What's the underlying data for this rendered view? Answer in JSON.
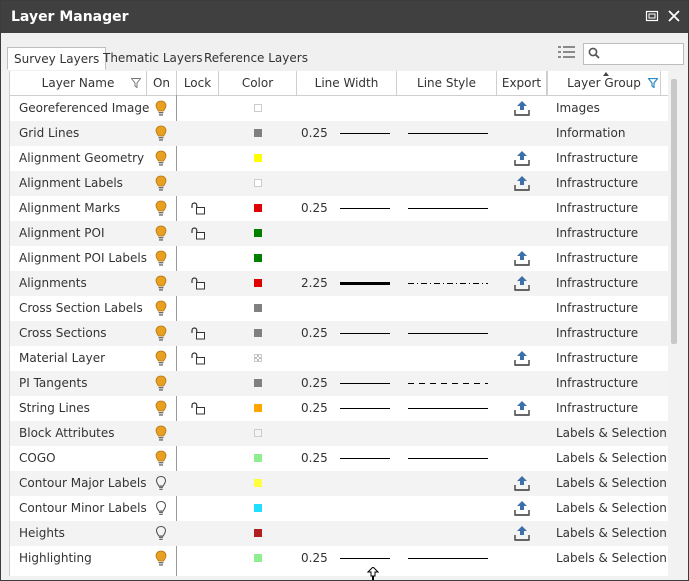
{
  "window": {
    "title": "Layer Manager"
  },
  "tabs": [
    {
      "label": "Survey Layers",
      "active": true
    },
    {
      "label": "Thematic Layers",
      "active": false
    },
    {
      "label": "Reference Layers",
      "active": false
    }
  ],
  "search": {
    "value": "",
    "placeholder": ""
  },
  "columns": {
    "name": "Layer Name",
    "on": "On",
    "lock": "Lock",
    "color": "Color",
    "width": "Line Width",
    "style": "Line Style",
    "export": "Export",
    "group": "Layer Group"
  },
  "colors": {
    "bulb_on": "#e8a020",
    "bulb_off": "#555555",
    "title_bar": "#404040",
    "accent": "#2b6cc4"
  },
  "rows": [
    {
      "name": "Georeferenced Images",
      "on": true,
      "locked": false,
      "color": "#ffffff",
      "width": "",
      "style": "",
      "export": true,
      "group": "Images"
    },
    {
      "name": "Grid Lines",
      "on": true,
      "locked": false,
      "color": "#808080",
      "width": "0.25",
      "style": "solid",
      "export": false,
      "group": "Information"
    },
    {
      "name": "Alignment Geometry",
      "on": true,
      "locked": false,
      "color": "#ffff00",
      "width": "",
      "style": "",
      "export": true,
      "group": "Infrastructure"
    },
    {
      "name": "Alignment Labels",
      "on": true,
      "locked": false,
      "color": "#ffffff",
      "width": "",
      "style": "",
      "export": true,
      "group": "Infrastructure"
    },
    {
      "name": "Alignment Marks",
      "on": true,
      "locked": true,
      "color": "#e00000",
      "width": "0.25",
      "style": "solid",
      "export": false,
      "group": "Infrastructure"
    },
    {
      "name": "Alignment POI",
      "on": true,
      "locked": true,
      "color": "#008000",
      "width": "",
      "style": "",
      "export": false,
      "group": "Infrastructure"
    },
    {
      "name": "Alignment POI Labels",
      "on": true,
      "locked": false,
      "color": "#008000",
      "width": "",
      "style": "",
      "export": true,
      "group": "Infrastructure"
    },
    {
      "name": "Alignments",
      "on": true,
      "locked": true,
      "color": "#e00000",
      "width": "2.25",
      "style": "dashdot",
      "export": true,
      "group": "Infrastructure"
    },
    {
      "name": "Cross Section Labels",
      "on": true,
      "locked": false,
      "color": "#808080",
      "width": "",
      "style": "",
      "export": false,
      "group": "Infrastructure"
    },
    {
      "name": "Cross Sections",
      "on": true,
      "locked": true,
      "color": "#808080",
      "width": "0.25",
      "style": "solid",
      "export": false,
      "group": "Infrastructure"
    },
    {
      "name": "Material Layer",
      "on": true,
      "locked": true,
      "color": "checker",
      "width": "",
      "style": "",
      "export": true,
      "group": "Infrastructure"
    },
    {
      "name": "PI Tangents",
      "on": true,
      "locked": false,
      "color": "#808080",
      "width": "0.25",
      "style": "dashed",
      "export": false,
      "group": "Infrastructure"
    },
    {
      "name": "String Lines",
      "on": true,
      "locked": true,
      "color": "#ffa500",
      "width": "0.25",
      "style": "solid",
      "export": true,
      "group": "Infrastructure"
    },
    {
      "name": "Block Attributes",
      "on": true,
      "locked": false,
      "color": "#f4f4f4",
      "width": "",
      "style": "",
      "export": false,
      "group": "Labels & Selection"
    },
    {
      "name": "COGO",
      "on": true,
      "locked": false,
      "color": "#90ee90",
      "width": "0.25",
      "style": "solid",
      "export": false,
      "group": "Labels & Selection"
    },
    {
      "name": "Contour Major Labels",
      "on": false,
      "locked": false,
      "color": "#ffff40",
      "width": "",
      "style": "",
      "export": true,
      "group": "Labels & Selection"
    },
    {
      "name": "Contour Minor Labels",
      "on": false,
      "locked": false,
      "color": "#20e0ff",
      "width": "",
      "style": "",
      "export": true,
      "group": "Labels & Selection"
    },
    {
      "name": "Heights",
      "on": false,
      "locked": false,
      "color": "#b02020",
      "width": "",
      "style": "",
      "export": true,
      "group": "Labels & Selection"
    },
    {
      "name": "Highlighting",
      "on": true,
      "locked": false,
      "color": "#90ee90",
      "width": "0.25",
      "style": "solid",
      "export": false,
      "group": "Labels & Selection"
    }
  ]
}
